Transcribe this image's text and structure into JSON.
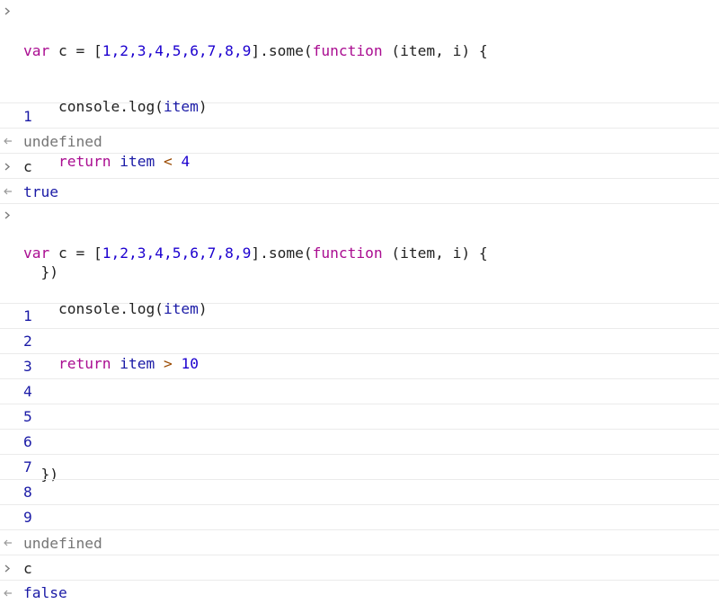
{
  "colors": {
    "keyword": "#aa0d91",
    "number": "#1c00cf",
    "operator": "#9a4a00",
    "output_value": "#1a1aa6",
    "undefined_text": "#757575",
    "row_divider": "#ebebeb"
  },
  "icons": {
    "input_prompt": "chevron-right-icon",
    "return_marker": "return-arrow-icon"
  },
  "block1": {
    "t_var": "var",
    "t_c_decl": " c = [",
    "t_array": "1,2,3,4,5,6,7,8,9",
    "t_after_array": "].some(",
    "t_function": "function",
    "t_params_open": " (",
    "t_param_item": "item",
    "t_params_rest": ", i) {",
    "line2_prefix": "    console.log(",
    "line2_arg": "item",
    "line2_suffix": ")",
    "line3_return": "return",
    "line3_sp": " ",
    "line3_item": "item",
    "line3_op": "<",
    "line3_num": "4",
    "line5": "  })"
  },
  "block1_outputs": [
    "1"
  ],
  "result1": "undefined",
  "eval1_input": "c",
  "eval1_result": "true",
  "block2": {
    "t_var": "var",
    "t_c_decl": " c = [",
    "t_array": "1,2,3,4,5,6,7,8,9",
    "t_after_array": "].some(",
    "t_function": "function",
    "t_params_open": " (",
    "t_param_item": "item",
    "t_params_rest": ", i) {",
    "line2_prefix": "    console.log(",
    "line2_arg": "item",
    "line2_suffix": ")",
    "line3_return": "return",
    "line3_sp": " ",
    "line3_item": "item",
    "line3_op": ">",
    "line3_num": "10",
    "line5": "  })"
  },
  "block2_outputs": [
    "1",
    "2",
    "3",
    "4",
    "5",
    "6",
    "7",
    "8",
    "9"
  ],
  "result2": "undefined",
  "eval2_input": "c",
  "eval2_result": "false"
}
